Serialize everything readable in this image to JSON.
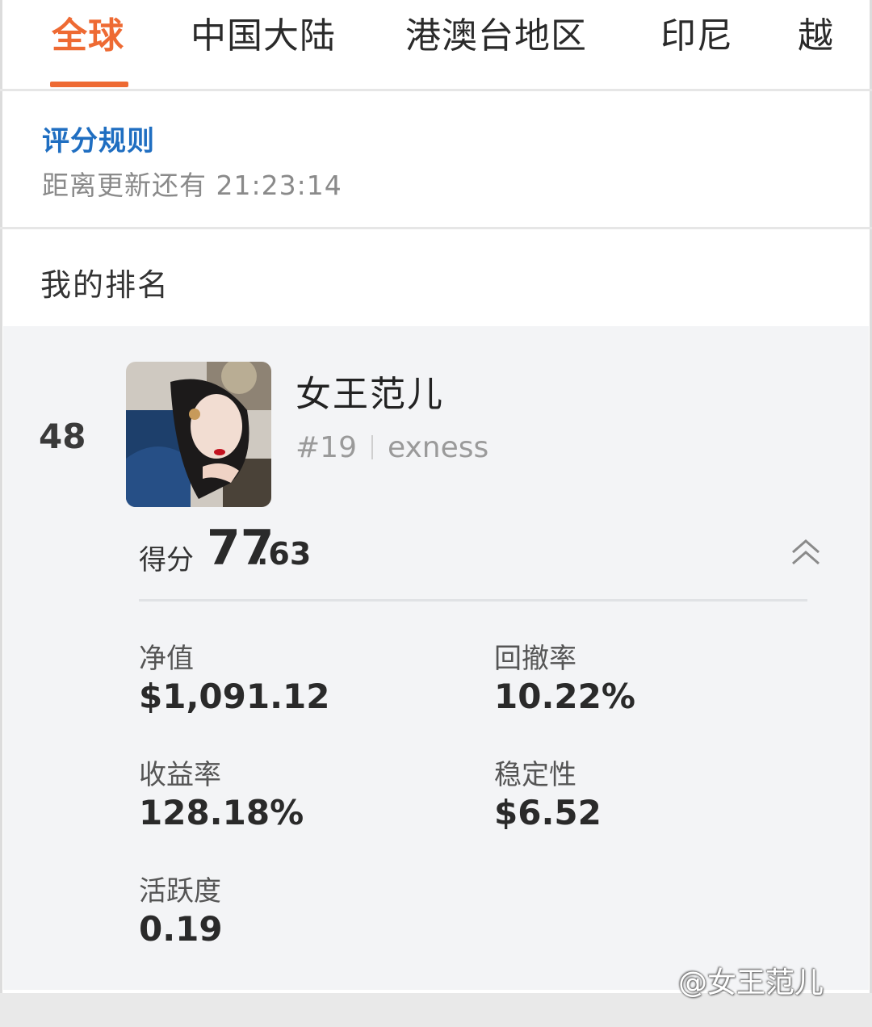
{
  "tabs": [
    {
      "label": "全球",
      "active": true
    },
    {
      "label": "中国大陆",
      "active": false
    },
    {
      "label": "港澳台地区",
      "active": false
    },
    {
      "label": "印尼",
      "active": false
    },
    {
      "label": "越",
      "active": false
    }
  ],
  "rules": {
    "link_label": "评分规则",
    "countdown": "距离更新还有 21:23:14"
  },
  "my_ranking": {
    "title": "我的排名",
    "rank": "48",
    "user": {
      "name": "女王范儿",
      "id": "#19",
      "broker": "exness"
    },
    "score": {
      "label": "得分",
      "integer": "77",
      "decimal": ".63"
    },
    "metrics": [
      {
        "label": "净值",
        "value": "$1,091.12"
      },
      {
        "label": "回撤率",
        "value": "10.22%"
      },
      {
        "label": "收益率",
        "value": "128.18%"
      },
      {
        "label": "稳定性",
        "value": "$6.52"
      },
      {
        "label": "活跃度",
        "value": "0.19"
      }
    ]
  },
  "watermark": "@女王范儿",
  "colors": {
    "accent": "#ee6a33",
    "link": "#1f6ec1",
    "card_bg": "#f3f4f6"
  }
}
